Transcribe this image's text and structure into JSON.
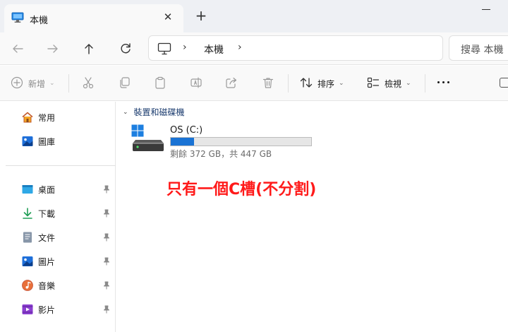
{
  "window": {
    "tab_title": "本機",
    "icons": {
      "tab": "computer-icon",
      "close": "close-icon",
      "new_tab": "plus-icon",
      "minimize": "minimize-icon"
    }
  },
  "nav": {
    "address_text": "本機",
    "search_placeholder": "搜尋 本機",
    "icons": [
      "back-arrow-icon",
      "forward-arrow-icon",
      "up-arrow-icon",
      "refresh-icon",
      "computer-icon",
      "chevron-right-icon"
    ]
  },
  "toolbar": {
    "new_label": "新增",
    "sort_label": "排序",
    "view_label": "檢視",
    "icons": [
      "plus-circle-icon",
      "cut-icon",
      "copy-icon",
      "paste-icon",
      "rename-icon",
      "share-icon",
      "delete-icon",
      "sort-icon",
      "view-icon",
      "more-icon"
    ]
  },
  "sidebar": {
    "top_items": [
      {
        "label": "常用",
        "icon": "home-icon"
      },
      {
        "label": "圖庫",
        "icon": "gallery-icon"
      }
    ],
    "pinned_items": [
      {
        "label": "桌面",
        "icon": "desktop-icon"
      },
      {
        "label": "下載",
        "icon": "download-icon"
      },
      {
        "label": "文件",
        "icon": "document-icon"
      },
      {
        "label": "圖片",
        "icon": "pictures-icon"
      },
      {
        "label": "音樂",
        "icon": "music-icon"
      },
      {
        "label": "影片",
        "icon": "videos-icon"
      }
    ]
  },
  "main": {
    "group_label": "裝置和磁碟機",
    "drive": {
      "name": "OS (C:)",
      "space_text": "剩餘 372 GB，共 447 GB",
      "used_fraction": 0.168,
      "bar_color": "#1a73d4"
    },
    "annotation": "只有一個C槽(不分割)",
    "annotation_color": "#ff1a1a"
  },
  "colors": {
    "accent": "#1a73d4",
    "group_header": "#1a3b6e"
  }
}
